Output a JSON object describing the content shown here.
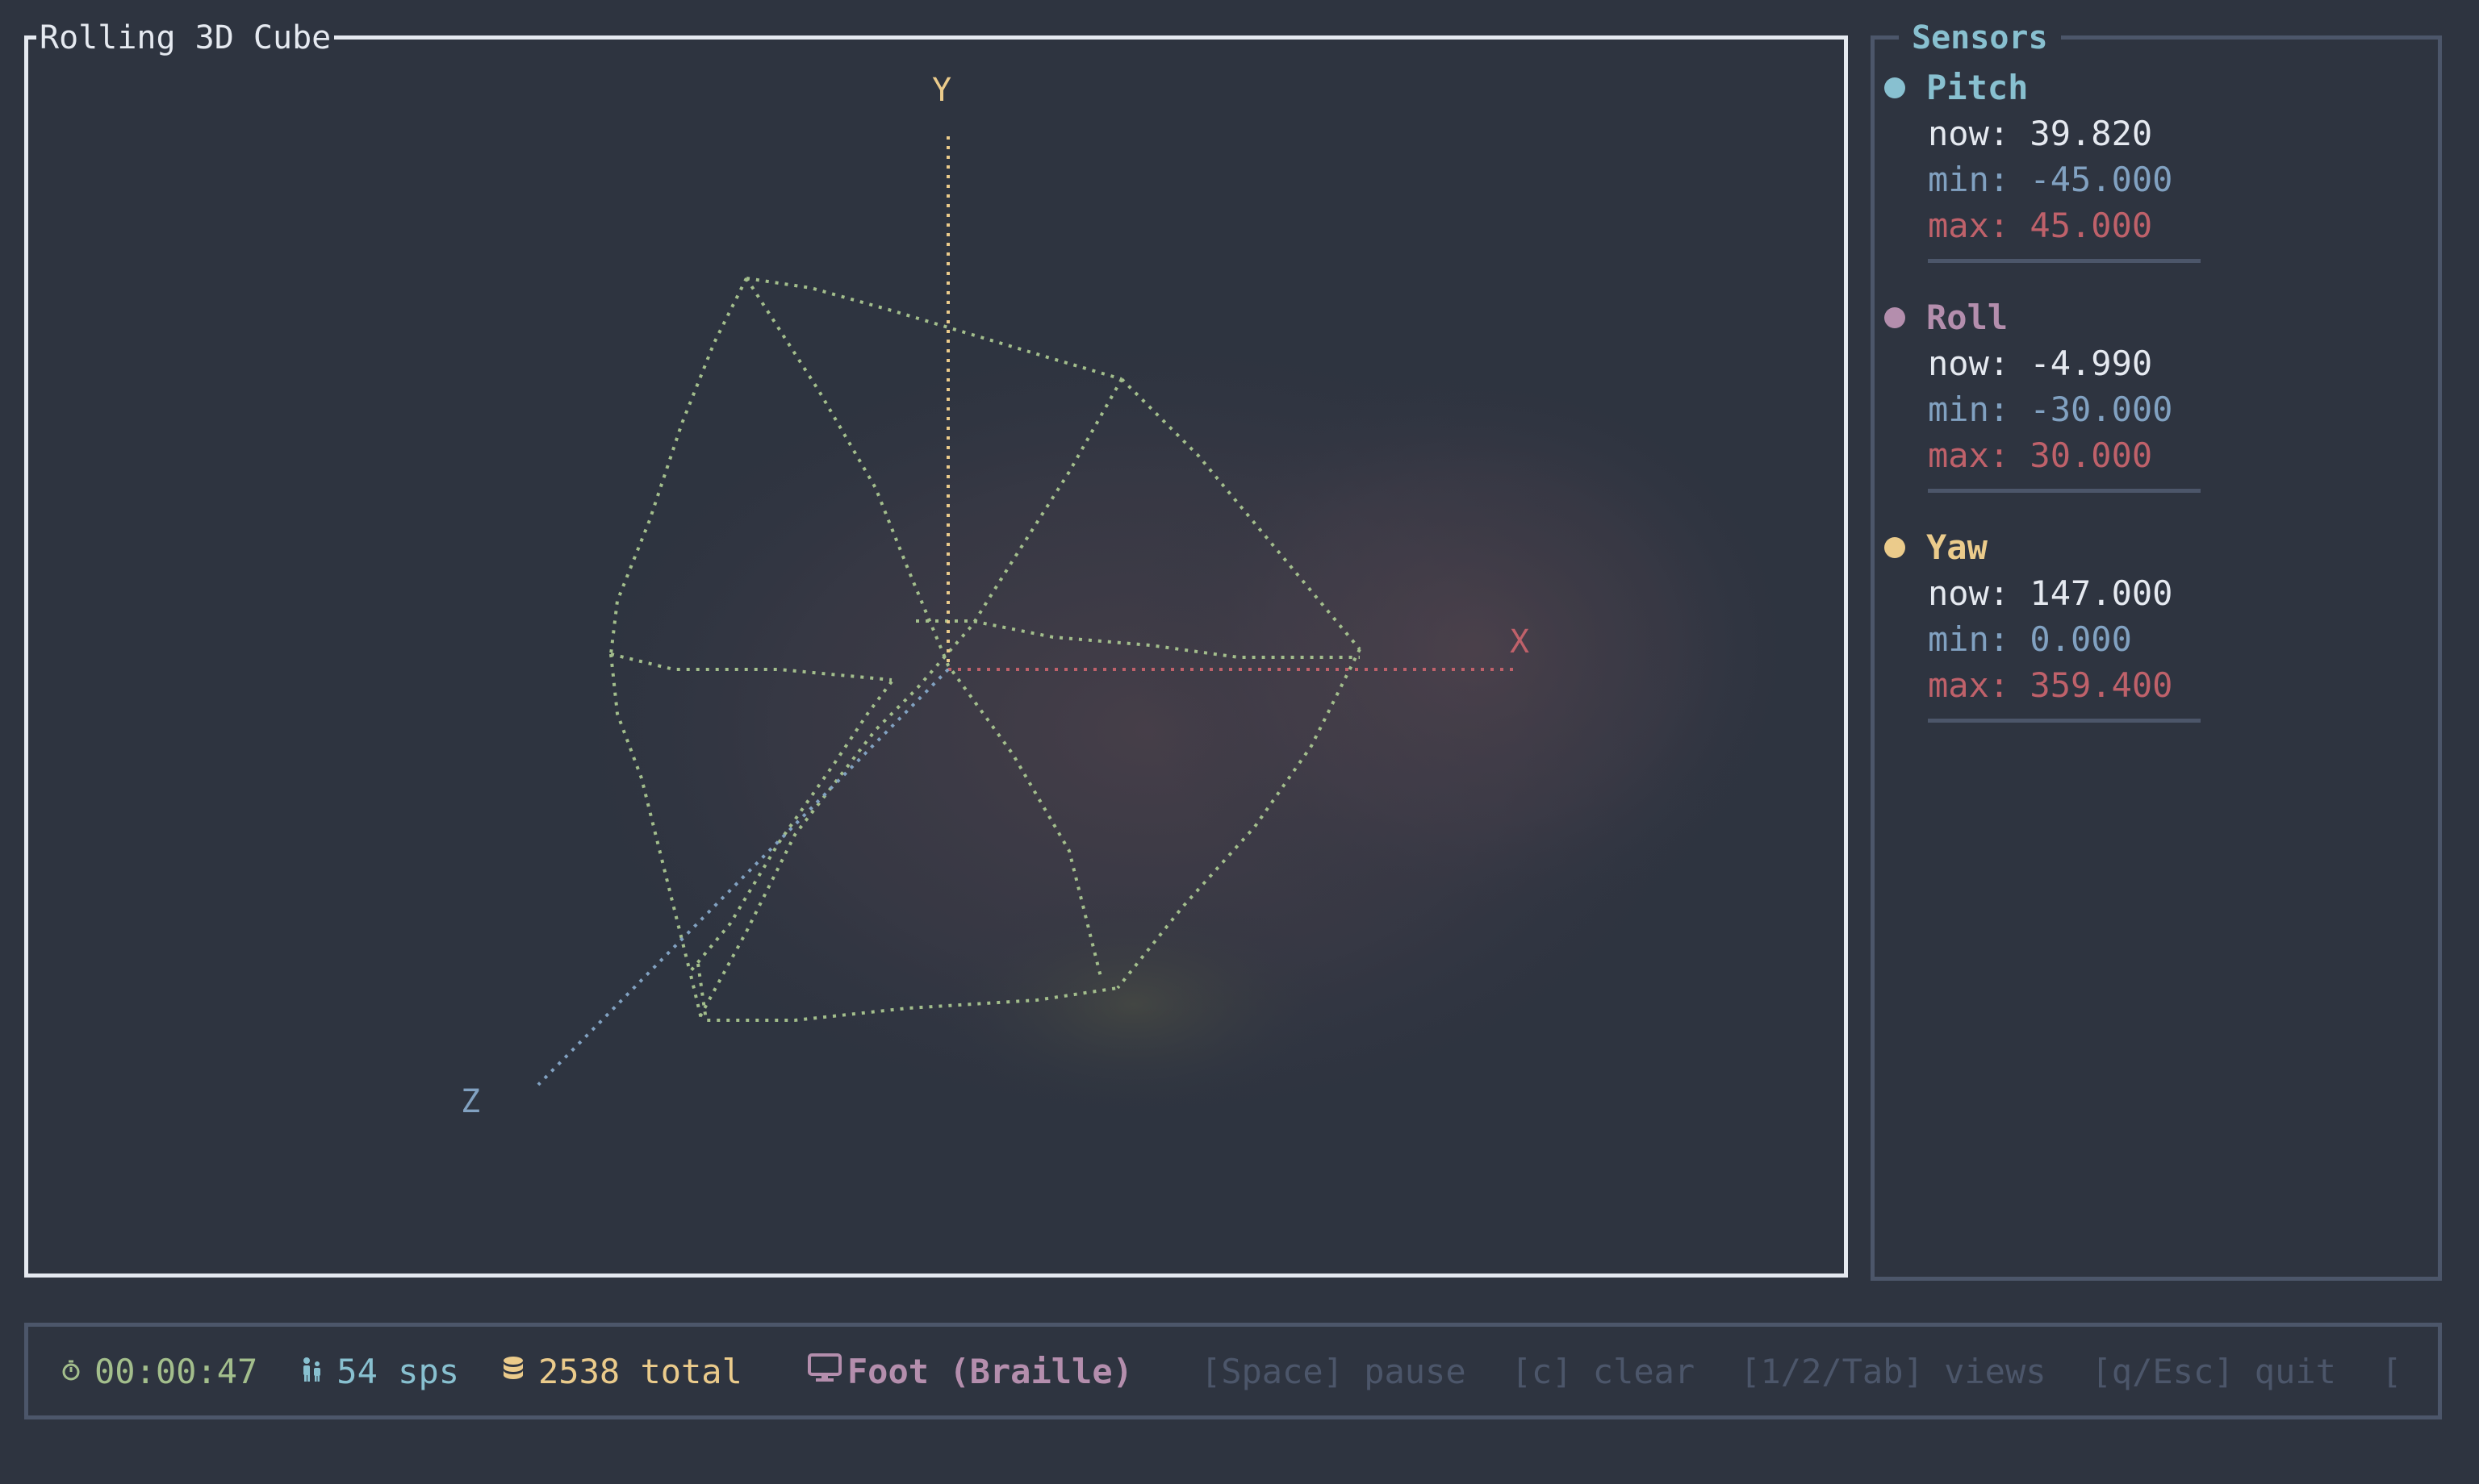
{
  "cube_panel": {
    "title": "Rolling 3D Cube",
    "axis_labels": {
      "x": "X",
      "y": "Y",
      "z": "Z"
    },
    "colors": {
      "edges": "#a3be8c",
      "x_axis": "#bf616a",
      "y_axis": "#ebcb8b",
      "z_axis": "#81a1c1"
    }
  },
  "sensors": {
    "title": "Sensors",
    "items": [
      {
        "name": "Pitch",
        "color": "#88c0d0",
        "now": "now: 39.820",
        "min": "min: -45.000",
        "max": "max: 45.000"
      },
      {
        "name": "Roll",
        "color": "#b48ead",
        "now": "now: -4.990",
        "min": "min: -30.000",
        "max": "max: 30.000"
      },
      {
        "name": "Yaw",
        "color": "#ebcb8b",
        "now": "now: 147.000",
        "min": "min: 0.000",
        "max": "max: 359.400"
      }
    ]
  },
  "status": {
    "elapsed": "00:00:47",
    "rate": "54 sps",
    "total": "2538 total",
    "mode": "Foot (Braille)",
    "hints": [
      "[Space] pause",
      "[c] clear",
      "[1/2/Tab] views",
      "[q/Esc] quit",
      "["
    ]
  }
}
